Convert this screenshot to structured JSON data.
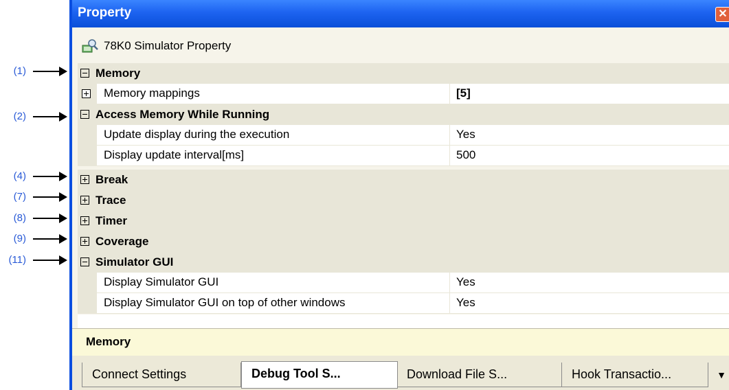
{
  "annotations": [
    "(1)",
    "(2)",
    "(4)",
    "(7)",
    "(8)",
    "(9)",
    "(11)"
  ],
  "window": {
    "title": "Property",
    "close_label": "✕"
  },
  "header": {
    "icon": "simulator-property-icon",
    "text": "78K0 Simulator Property"
  },
  "grid": {
    "rows": [
      {
        "kind": "category",
        "toggle": "⊟",
        "label": "Memory"
      },
      {
        "kind": "item",
        "toggle": "⊞",
        "name": "Memory mappings",
        "value": "[5]"
      },
      {
        "kind": "category",
        "toggle": "⊟",
        "label": "Access Memory While Running"
      },
      {
        "kind": "item",
        "name": "Update display during the execution",
        "value": "Yes"
      },
      {
        "kind": "item",
        "name": "Display update interval[ms]",
        "value": "500"
      },
      {
        "kind": "category",
        "toggle": "⊞",
        "label": "Break"
      },
      {
        "kind": "category",
        "toggle": "⊞",
        "label": "Trace"
      },
      {
        "kind": "category",
        "toggle": "⊞",
        "label": "Timer"
      },
      {
        "kind": "category",
        "toggle": "⊞",
        "label": "Coverage"
      },
      {
        "kind": "category",
        "toggle": "⊟",
        "label": "Simulator GUI"
      },
      {
        "kind": "item",
        "name": "Display Simulator GUI",
        "value": "Yes"
      },
      {
        "kind": "item",
        "name": "Display Simulator GUI on top of other windows",
        "value": "Yes"
      }
    ]
  },
  "description": {
    "text": "Memory"
  },
  "tabs": [
    "Connect Settings",
    "Debug Tool S...",
    "Download File S...",
    "Hook Transactio..."
  ],
  "active_tab": "Debug Tool S...",
  "tab_menu_icon": "▼",
  "colors": {
    "titlebar": "#1d63f0",
    "annotation": "#2a5bd7",
    "category_bg": "#e8e6d8",
    "description_bg": "#fbf9d8"
  }
}
